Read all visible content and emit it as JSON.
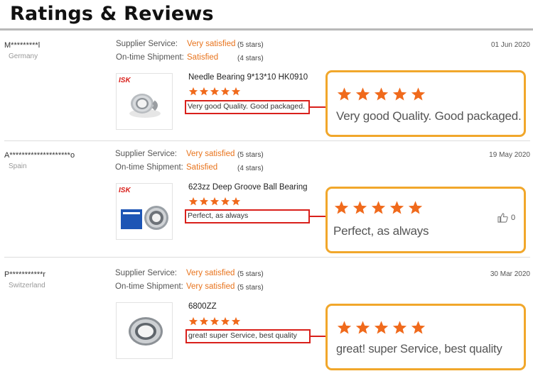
{
  "page": {
    "title": "Ratings & Reviews"
  },
  "labels": {
    "supplier_service": "Supplier Service:",
    "ontime_shipment": "On-time Shipment:"
  },
  "colors": {
    "accent_orange": "#e8731c",
    "star_orange": "#f06a1c",
    "highlight_red": "#d9201b",
    "zoom_border": "#f1a72b"
  },
  "reviews": [
    {
      "user": "M*********l",
      "country": "Germany",
      "date": "01 Jun 2020",
      "supplier_service": {
        "value": "Very satisfied",
        "stars": "(5 stars)"
      },
      "shipment": {
        "value": "Satisfied",
        "stars": "(4 stars)"
      },
      "product": {
        "name": "Needle Bearing 9*13*10 HK0910",
        "image_icon": "needle-bearing-image",
        "brand": "ISK"
      },
      "rating": 5,
      "comment": "Very good Quality. Good packaged.",
      "zoom_comment": "Very good Quality. Good packaged."
    },
    {
      "user": "A********************o",
      "country": "Spain",
      "date": "19 May 2020",
      "supplier_service": {
        "value": "Very satisfied",
        "stars": "(5 stars)"
      },
      "shipment": {
        "value": "Satisfied",
        "stars": "(4 stars)"
      },
      "product": {
        "name": "623zz Deep Groove Ball Bearing",
        "image_icon": "ball-bearing-box-image",
        "brand": "ISK"
      },
      "rating": 5,
      "comment": "Perfect, as always",
      "zoom_comment": "Perfect, as always",
      "helpful_count": "0"
    },
    {
      "user": "P***********r",
      "country": "Switzerland",
      "date": "30 Mar 2020",
      "supplier_service": {
        "value": "Very satisfied",
        "stars": "(5 stars)"
      },
      "shipment": {
        "value": "Very satisfied",
        "stars": "(5 stars)"
      },
      "product": {
        "name": "6800ZZ",
        "image_icon": "thin-bearing-image"
      },
      "rating": 5,
      "comment": "great! super Service, best quality",
      "zoom_comment": "great! super Service, best quality"
    }
  ]
}
